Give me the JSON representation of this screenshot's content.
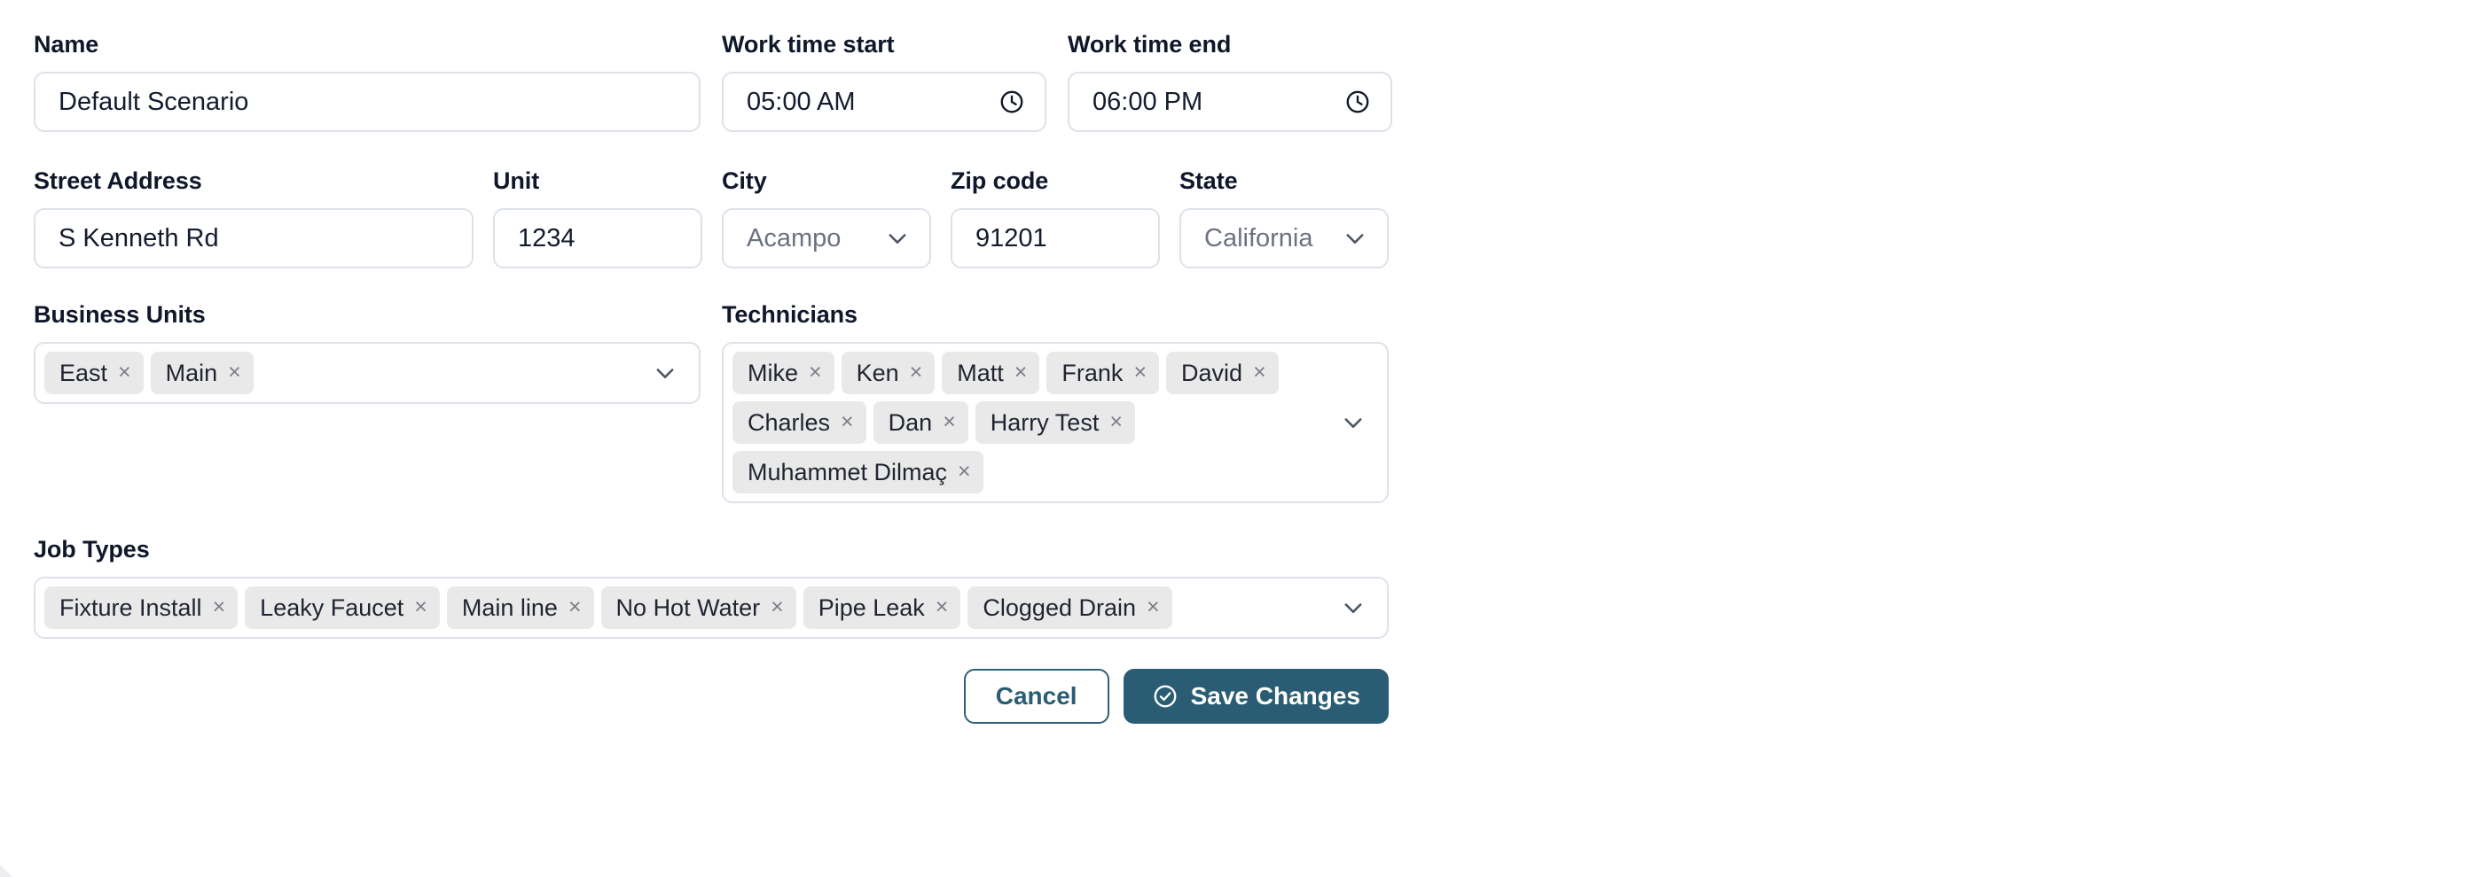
{
  "form": {
    "row1": {
      "name": {
        "label": "Name",
        "value": "Default Scenario"
      },
      "work_time_start": {
        "label": "Work time start",
        "value": "05:00 AM",
        "icon": "clock-icon"
      },
      "work_time_end": {
        "label": "Work time end",
        "value": "06:00 PM",
        "icon": "clock-icon"
      }
    },
    "row2": {
      "street_address": {
        "label": "Street Address",
        "value": "S Kenneth Rd"
      },
      "unit": {
        "label": "Unit",
        "value": "1234"
      },
      "city": {
        "label": "City",
        "value": "Acampo",
        "icon": "chevron-down-icon"
      },
      "zip_code": {
        "label": "Zip code",
        "value": "91201"
      },
      "state": {
        "label": "State",
        "value": "California",
        "icon": "chevron-down-icon"
      }
    },
    "business_units": {
      "label": "Business Units",
      "chips": [
        "East",
        "Main"
      ],
      "remove_glyph": "×",
      "icon": "chevron-down-icon"
    },
    "technicians": {
      "label": "Technicians",
      "chips": [
        "Mike",
        "Ken",
        "Matt",
        "Frank",
        "David",
        "Charles",
        "Dan",
        "Harry Test",
        "Muhammet Dilmaç"
      ],
      "remove_glyph": "×",
      "icon": "chevron-down-icon"
    },
    "job_types": {
      "label": "Job Types",
      "chips": [
        "Fixture Install",
        "Leaky Faucet",
        "Main line",
        "No Hot Water",
        "Pipe Leak",
        "Clogged Drain"
      ],
      "remove_glyph": "×",
      "icon": "chevron-down-icon"
    },
    "actions": {
      "cancel_label": "Cancel",
      "save_label": "Save Changes",
      "save_icon": "check-circle-icon"
    }
  },
  "colors": {
    "accent": "#2a5d73",
    "border": "#dde2ea",
    "chip_bg": "#e9e9ea",
    "text": "#131b2e",
    "muted_text": "#6b7280"
  }
}
